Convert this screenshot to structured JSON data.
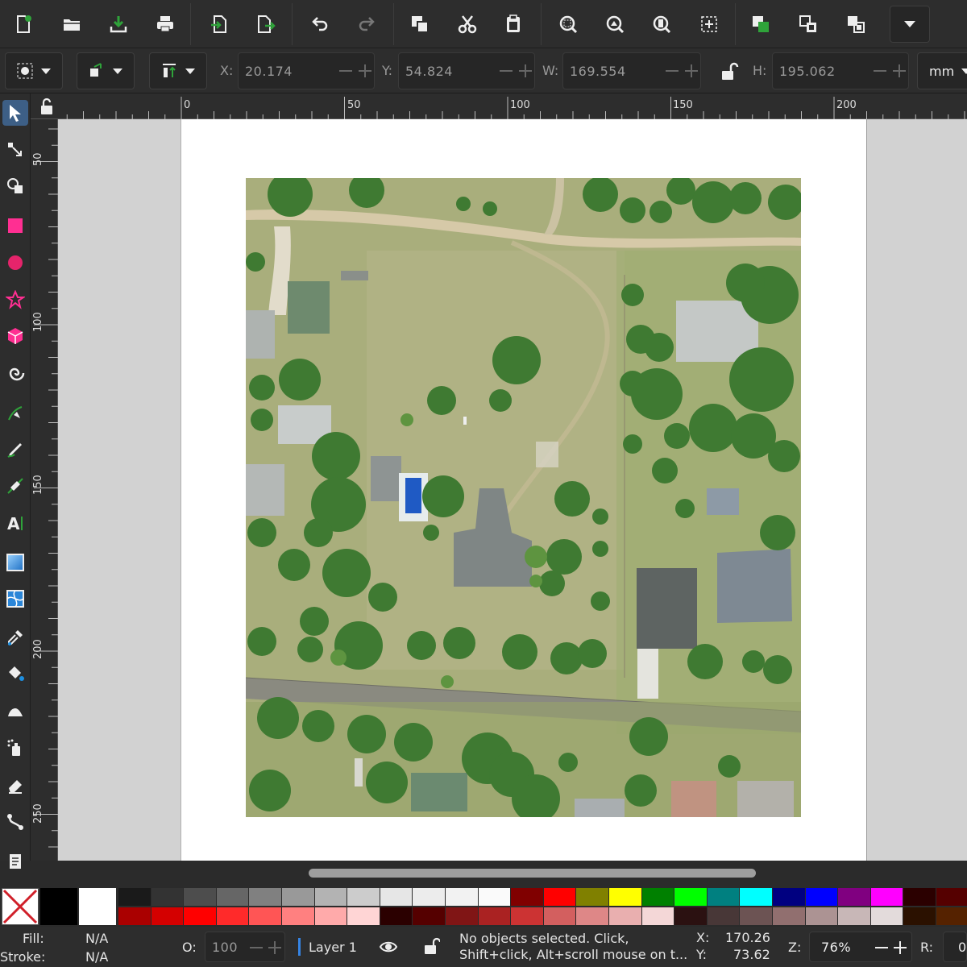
{
  "toolbar": {
    "icons": [
      "new-document-icon",
      "open-icon",
      "import-icon",
      "print-icon",
      "export-icon",
      "export-as-icon",
      "undo-icon",
      "redo-icon",
      "duplicate-icon",
      "cut-icon",
      "paste-icon",
      "zoom-selection-icon",
      "zoom-drawing-icon",
      "zoom-page-icon",
      "zoom-center-icon",
      "raise-icon",
      "group-icon",
      "ungroup-icon",
      "more-icon"
    ]
  },
  "context": {
    "x_label": "X:",
    "x_value": "20.174",
    "y_label": "Y:",
    "y_value": "54.824",
    "w_label": "W:",
    "w_value": "169.554",
    "h_label": "H:",
    "h_value": "195.062",
    "unit": "mm"
  },
  "ruler": {
    "top_labels": [
      "0",
      "50",
      "100",
      "150",
      "200"
    ],
    "left_labels": [
      "50",
      "100",
      "150",
      "200",
      "250"
    ]
  },
  "palette": {
    "row1": [
      "#1a1a1a",
      "#333333",
      "#4d4d4d",
      "#666666",
      "#808080",
      "#999999",
      "#b3b3b3",
      "#cccccc",
      "#e6e6e6",
      "#ececec",
      "#f2f2f2",
      "#fafafa",
      "#800000",
      "#ff0000",
      "#808000",
      "#ffff00",
      "#008000",
      "#00ff00",
      "#008080",
      "#00ffff",
      "#000080",
      "#0000ff",
      "#800080",
      "#ff00ff",
      "#2b0000",
      "#550000",
      "#800000"
    ],
    "row2": [
      "#aa0000",
      "#d40000",
      "#ff0000",
      "#ff2a2a",
      "#ff5555",
      "#ff8080",
      "#ffaaaa",
      "#ffd5d5",
      "#2b0000",
      "#550000",
      "#801515",
      "#aa2222",
      "#cc3333",
      "#d35f5f",
      "#de8787",
      "#e9afaf",
      "#f4d7d7",
      "#2b1111",
      "#483737",
      "#6c5353",
      "#916f6f",
      "#ac9393",
      "#c8b7b7",
      "#e3dbdb",
      "#2b1100",
      "#552200",
      "#803300"
    ]
  },
  "status": {
    "fill_label": "Fill:",
    "fill_value": "N/A",
    "stroke_label": "Stroke:",
    "stroke_value": "N/A",
    "opacity_label": "O:",
    "opacity_value": "100",
    "layer": "Layer 1",
    "message_line1": "No objects selected. Click,",
    "message_line2": "Shift+click, Alt+scroll mouse on t...",
    "cursor_x_label": "X:",
    "cursor_x": "170.26",
    "cursor_y_label": "Y:",
    "cursor_y": "73.62",
    "zoom_label": "Z:",
    "zoom": "76%",
    "rotate_label": "R:",
    "rotate": "0"
  }
}
